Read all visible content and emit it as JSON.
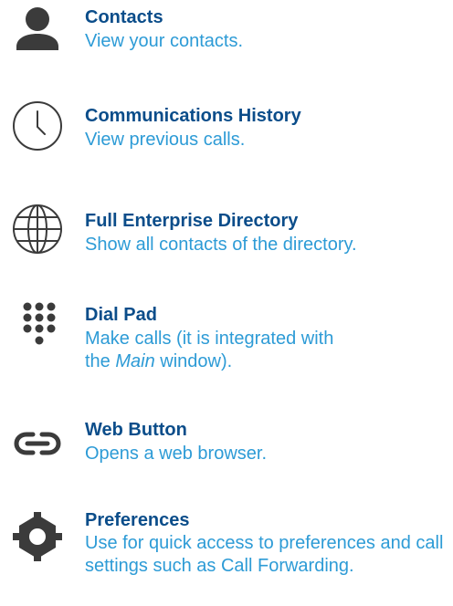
{
  "accent_title_color": "#0b4d8a",
  "accent_text_color": "#2d9bd6",
  "icon_color": "#3b3b3b",
  "items": [
    {
      "icon": "person-icon",
      "title": "Contacts",
      "description": "View your contacts."
    },
    {
      "icon": "clock-icon",
      "title": "Communications History",
      "description": "View previous calls."
    },
    {
      "icon": "globe-icon",
      "title": "Full Enterprise Directory",
      "description": "Show all contacts of the directory."
    },
    {
      "icon": "dialpad-icon",
      "title": "Dial Pad",
      "description_prefix": "Make calls (it is integrated with the ",
      "description_emphasis": "Main",
      "description_suffix": " window)."
    },
    {
      "icon": "link-icon",
      "title": "Web Button",
      "description": "Opens a web browser."
    },
    {
      "icon": "gear-icon",
      "title": "Preferences",
      "description": "Use for quick access to preferences and call settings such as Call Forwarding."
    }
  ]
}
